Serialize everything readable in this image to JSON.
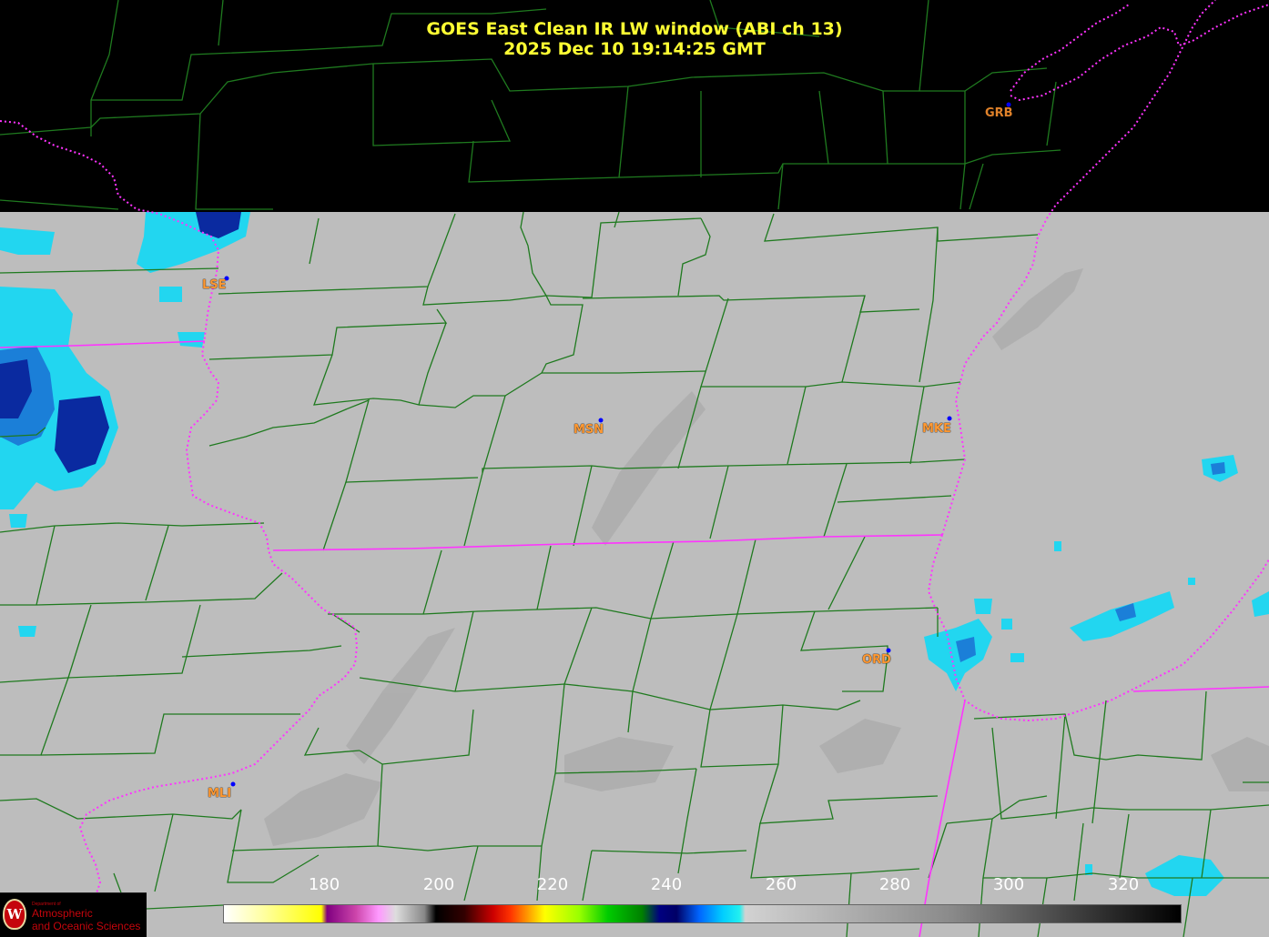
{
  "title": {
    "line1": "GOES East Clean IR LW window (ABI ch 13)",
    "line2": "2025 Dec 10  19:14:25 GMT"
  },
  "stations": [
    {
      "id": "GRB"
    },
    {
      "id": "LSE"
    },
    {
      "id": "MSN"
    },
    {
      "id": "MKE"
    },
    {
      "id": "ORD"
    },
    {
      "id": "MLI"
    }
  ],
  "colorbar": {
    "ticks": [
      "180",
      "200",
      "220",
      "240",
      "260",
      "280",
      "300",
      "320"
    ],
    "min": 163,
    "max": 330
  },
  "logo": {
    "dept": "Department of",
    "line1": "Atmospheric",
    "line2": "and Oceanic Sciences"
  },
  "colors": {
    "county_lines": "#1f7a1f",
    "state_lines": "#ff33ff",
    "title": "#ffff33",
    "station_label": "#ff9933",
    "station_dot": "#0000ff",
    "cloud_cyan": "#22d6f0",
    "cloud_blue": "#0a2aa0"
  }
}
